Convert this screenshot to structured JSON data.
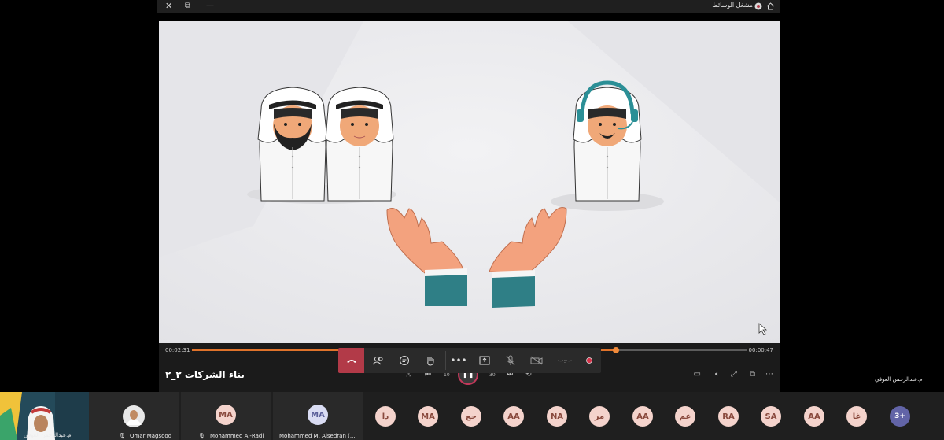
{
  "colors": {
    "accent": "#e0732b",
    "hangup": "#b23a48",
    "avatar_bg": "#f4d3cc",
    "avatar_fg": "#8a4a3e",
    "more_bg": "#6264a7"
  },
  "topbar": {
    "close_icon": "close-icon",
    "popout_icon": "popout-icon",
    "media_title": "مشغل الوسائط",
    "media_icon": "record-icon",
    "home_icon": "home-icon"
  },
  "player": {
    "elapsed": "00:02:31",
    "remaining": "00:00:47",
    "progress": 0.765,
    "media_name": "بناء الشركات ٢_٢"
  },
  "presenter": {
    "name": "م.عبدالرحمن العوفي"
  },
  "participants": [
    {
      "name": "م.عبدالرحمن العوفي",
      "type": "video"
    },
    {
      "name": "Omar Magsood",
      "type": "photo",
      "muted": true
    },
    {
      "name": "Mohammed Al-Radi",
      "initials": "MA",
      "muted": true
    },
    {
      "name": "Mohammed M. Alsedran (...",
      "initials": "MA"
    }
  ],
  "avatars": [
    "دا",
    "MA",
    "حع",
    "AA",
    "NA",
    "مر",
    "AA",
    "عم",
    "RA",
    "SA",
    "AA",
    "غا"
  ],
  "more_count": "3+"
}
